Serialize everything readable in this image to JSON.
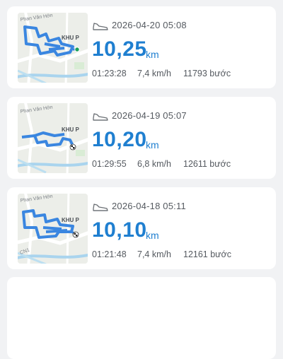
{
  "activities": [
    {
      "datetime": "2026-04-20 05:08",
      "distance": "10,25",
      "unit": "km",
      "duration": "01:23:28",
      "speed": "7,4 km/h",
      "steps": "11793 bước",
      "map_labels": [
        "Phan Văn Hớn",
        "KHU P"
      ],
      "end_marker": "green-dot",
      "activity_icon": "shoe-icon"
    },
    {
      "datetime": "2026-04-19 05:07",
      "distance": "10,20",
      "unit": "km",
      "duration": "01:29:55",
      "speed": "6,8 km/h",
      "steps": "12611 bước",
      "map_labels": [
        "Phan Văn Hớn",
        "KHU P"
      ],
      "end_marker": "checkered-flag",
      "activity_icon": "shoe-icon"
    },
    {
      "datetime": "2026-04-18 05:11",
      "distance": "10,10",
      "unit": "km",
      "duration": "01:21:48",
      "speed": "7,4 km/h",
      "steps": "12161 bước",
      "map_labels": [
        "Phan Văn Hớn",
        "KHU P",
        "CN1"
      ],
      "end_marker": "checkered-flag",
      "activity_icon": "shoe-icon"
    }
  ],
  "colors": {
    "accent": "#1f7fd0",
    "route": "#3a86e0",
    "text_secondary": "#555a60",
    "background": "#f1f2f4",
    "card": "#ffffff"
  }
}
